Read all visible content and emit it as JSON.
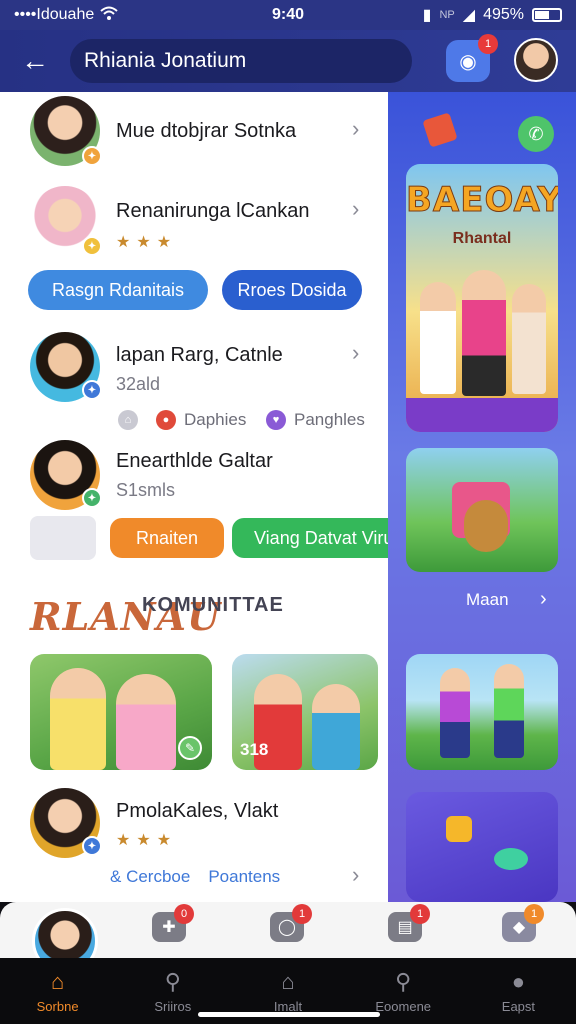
{
  "status": {
    "carrier": "••••Idouahe",
    "time": "9:40",
    "network": "NP",
    "battery": "495%"
  },
  "header": {
    "title": "Rhiania Jonatium",
    "camera_badge": "1"
  },
  "contacts": [
    {
      "name": "Mue dtobjrar Sotnka",
      "badge_color": "#f0a33c"
    },
    {
      "name": "Renanirunga lCankan",
      "stars": "★★★",
      "badge_color": "#f0c03c"
    },
    {
      "name": "lapan Rarg, Catnle",
      "sub": "32ald",
      "badge_color": "#3f78d8"
    },
    {
      "name": "Enearthlde Galtar",
      "sub": "S1smls",
      "badge_color": "#44b36a"
    }
  ],
  "pills_row1": [
    {
      "label": "Rasgn Rdanitais",
      "color": "#3f8ae0"
    },
    {
      "label": "Rroes Dosida",
      "color": "#2a5fcf"
    }
  ],
  "meta": [
    {
      "label": "Daphies",
      "color": "#e04a3a"
    },
    {
      "label": "Panghles",
      "color": "#8a5ad6"
    }
  ],
  "pills_row2": [
    {
      "label": "Rnaiten",
      "color": "#f08a2a"
    },
    {
      "label": "Viang Datvat Viru",
      "color": "#34b85a"
    }
  ],
  "section": {
    "script": "RLANAU",
    "title": "KOMUNITTAE"
  },
  "photos": [
    {
      "label": ""
    },
    {
      "label": "318"
    }
  ],
  "contact5": {
    "name": "PmolaKales, Vlakt",
    "stars": "★★★",
    "action1": "Cercboe",
    "action2": "Poantens"
  },
  "rail": {
    "banner_title": "BAEOAY",
    "banner_sub": "Rhantal",
    "label": "Maan"
  },
  "dock": {
    "badges": [
      "0",
      "1",
      "1",
      "1"
    ]
  },
  "tabs": [
    {
      "label": "Sorbne",
      "icon": "home-icon",
      "active": true
    },
    {
      "label": "Sriiros",
      "icon": "search-icon",
      "active": false
    },
    {
      "label": "Imalt",
      "icon": "house-icon",
      "active": false
    },
    {
      "label": "Eoomene",
      "icon": "search-icon",
      "active": false
    },
    {
      "label": "Eapst",
      "icon": "person-icon",
      "active": false
    }
  ]
}
